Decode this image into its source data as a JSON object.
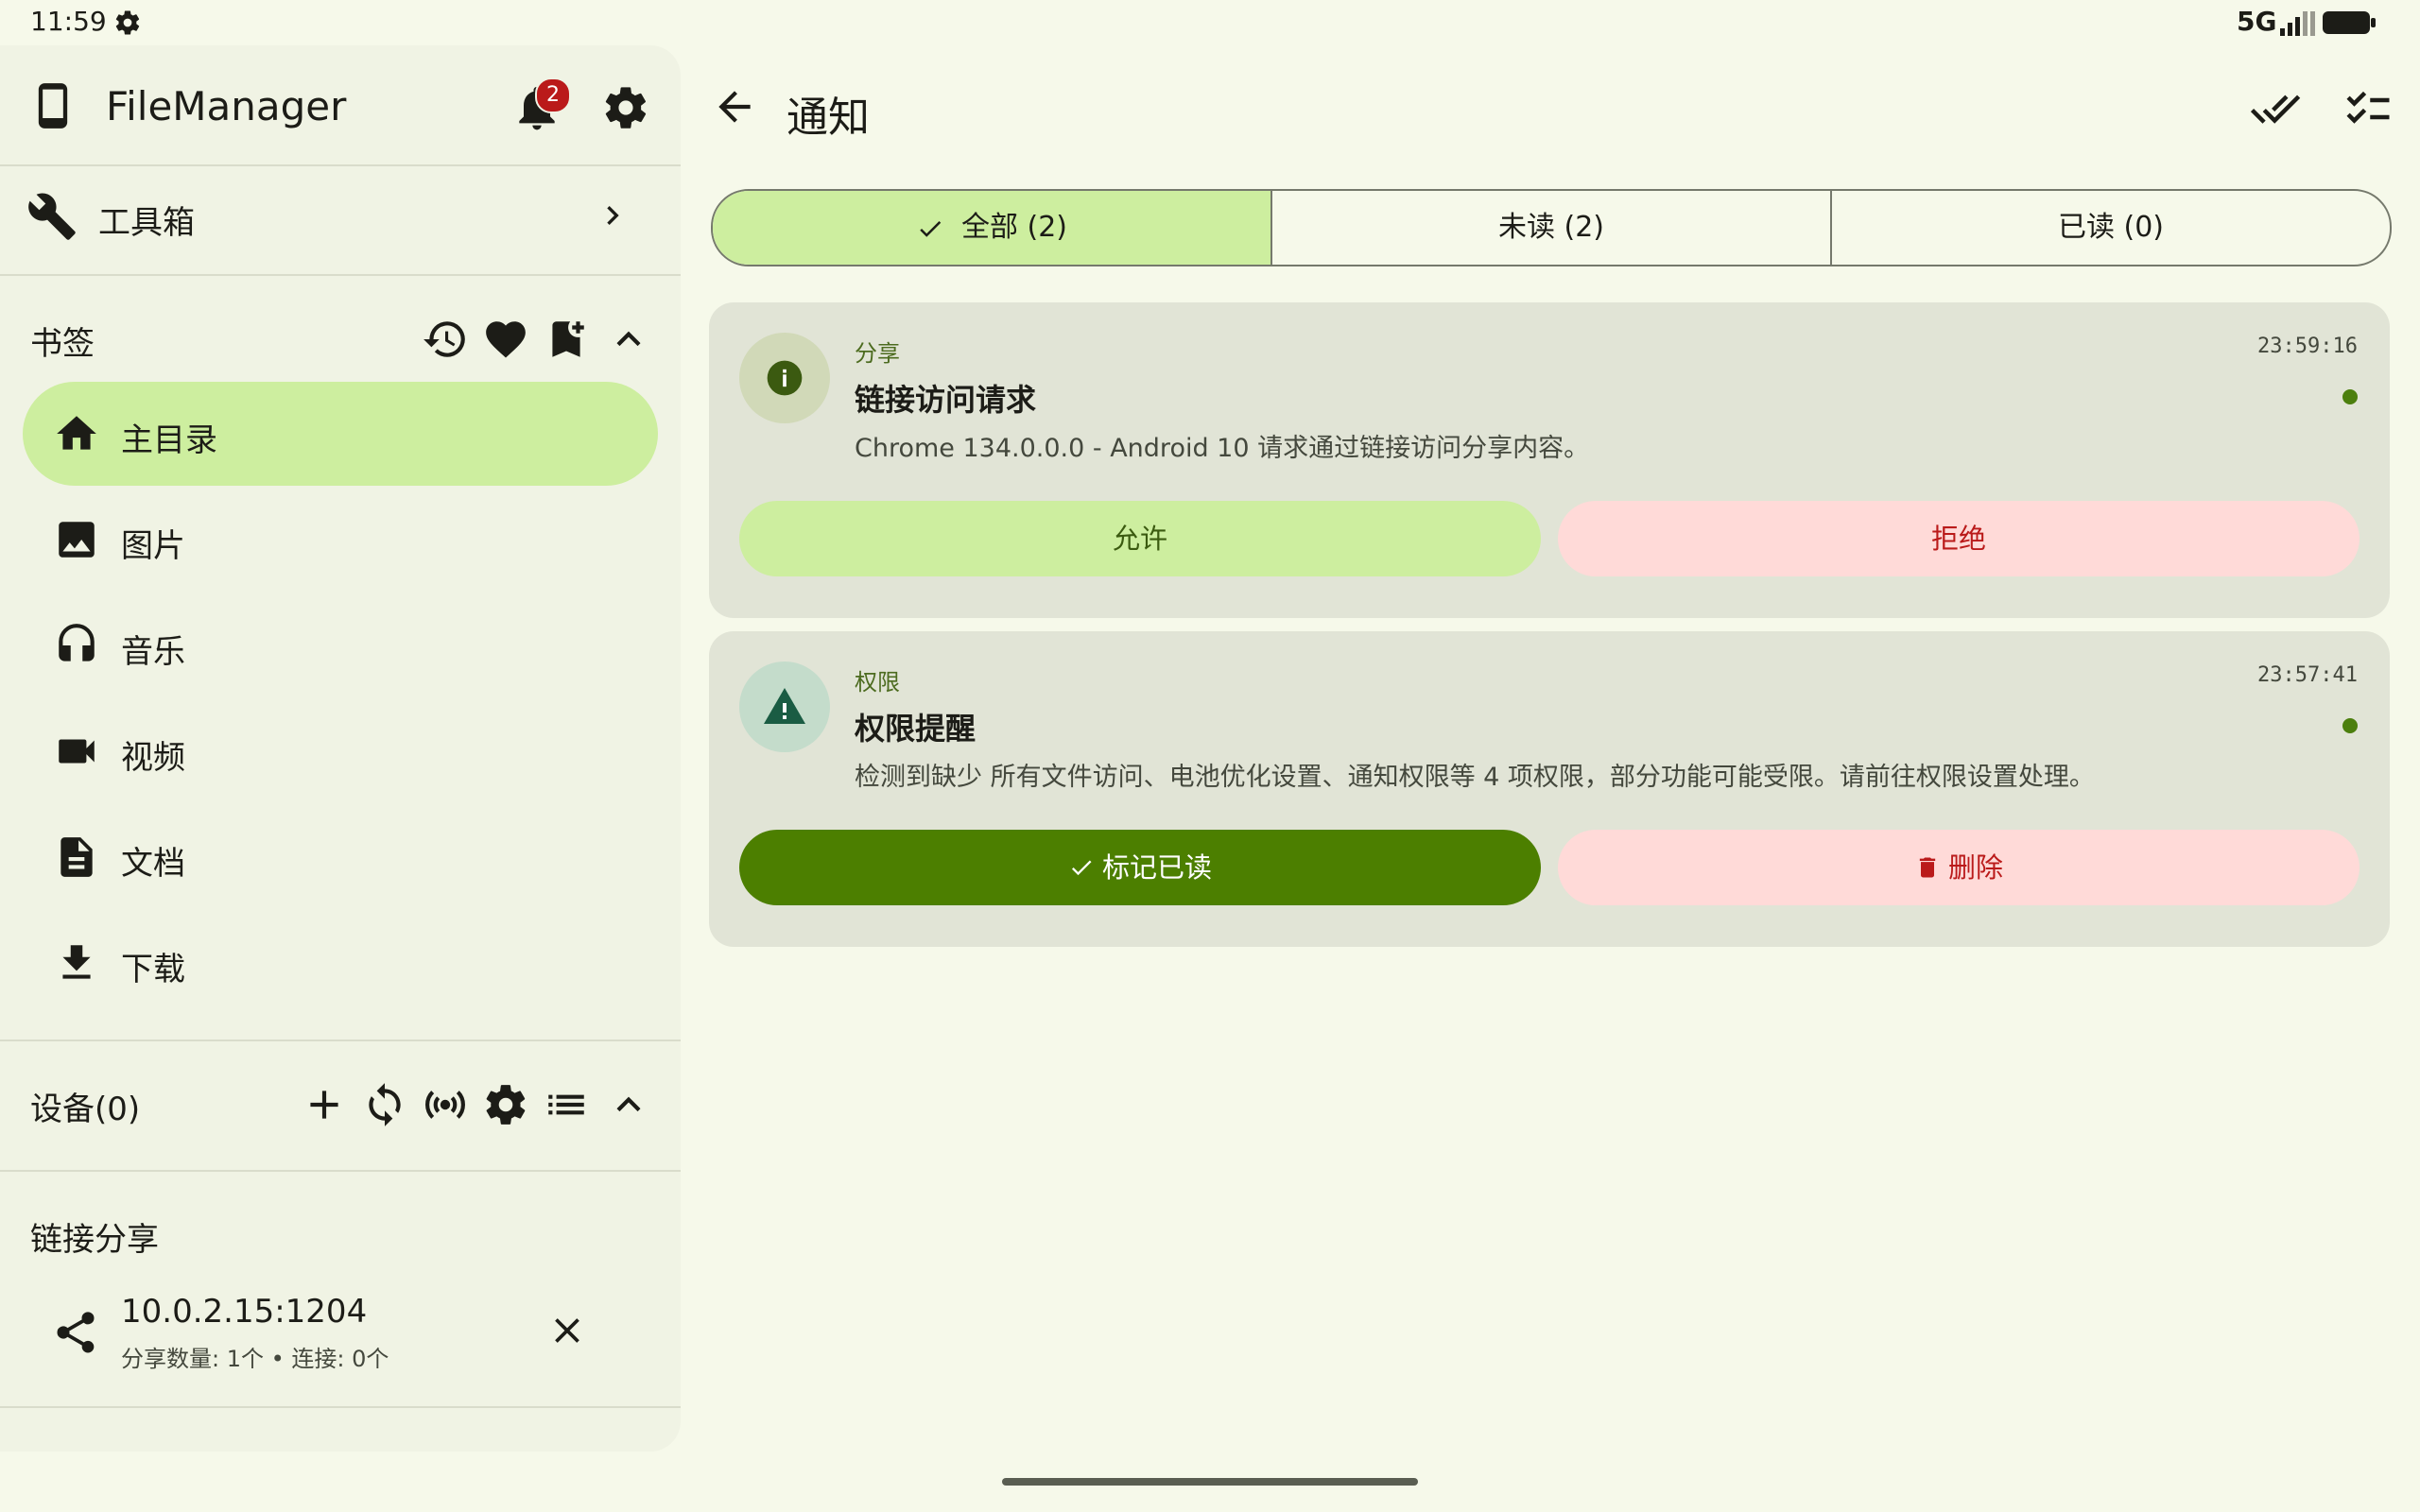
{
  "status_bar": {
    "time": "11:59",
    "network": "5G"
  },
  "sidebar": {
    "app_title": "FileManager",
    "notification_count": "2",
    "toolbox_label": "工具箱",
    "bookmarks": {
      "title": "书签",
      "items": [
        {
          "label": "主目录",
          "icon": "home-icon"
        },
        {
          "label": "图片",
          "icon": "image-icon"
        },
        {
          "label": "音乐",
          "icon": "headphones-icon"
        },
        {
          "label": "视频",
          "icon": "video-icon"
        },
        {
          "label": "文档",
          "icon": "document-icon"
        },
        {
          "label": "下载",
          "icon": "download-icon"
        }
      ]
    },
    "devices_title": "设备(0)",
    "link_share": {
      "title": "链接分享",
      "address": "10.0.2.15:1204",
      "subtitle": "分享数量: 1个 • 连接: 0个"
    }
  },
  "main": {
    "title": "通知",
    "tabs": [
      {
        "label": "全部 (2)",
        "active": true
      },
      {
        "label": "未读 (2)",
        "active": false
      },
      {
        "label": "已读 (0)",
        "active": false
      }
    ],
    "notifications": [
      {
        "category": "分享",
        "time": "23:59:16",
        "title": "链接访问请求",
        "body": "Chrome 134.0.0.0 - Android 10 请求通过链接访问分享内容。",
        "primary_action": "允许",
        "secondary_action": "拒绝",
        "icon": "info-icon"
      },
      {
        "category": "权限",
        "time": "23:57:41",
        "title": "权限提醒",
        "body": "检测到缺少 所有文件访问、电池优化设置、通知权限等 4 项权限，部分功能可能受限。请前往权限设置处理。",
        "primary_action": "标记已读",
        "secondary_action": "删除",
        "icon": "warning-icon"
      }
    ]
  },
  "colors": {
    "background": "#f6f9ea",
    "accent_container": "#cdee9f",
    "primary": "#4c7f00",
    "error_container": "#ffdad8",
    "error": "#ba1a1a"
  }
}
